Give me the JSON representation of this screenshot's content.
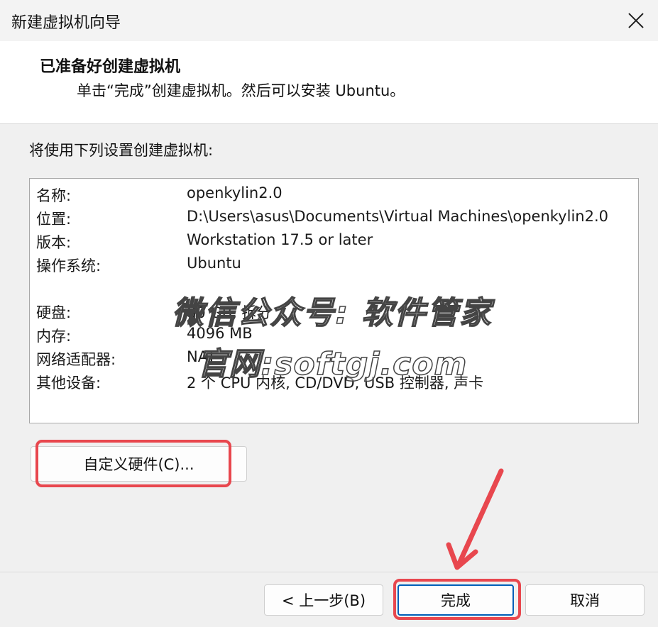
{
  "window": {
    "title": "新建虚拟机向导",
    "close_icon": "close-icon"
  },
  "header": {
    "title": "已准备好创建虚拟机",
    "subtitle": "单击“完成”创建虚拟机。然后可以安装 Ubuntu。"
  },
  "intro": "将使用下列设置创建虚拟机:",
  "settings": [
    {
      "label": "名称:",
      "value": "openkylin2.0"
    },
    {
      "label": "位置:",
      "value": "D:\\Users\\asus\\Documents\\Virtual Machines\\openkylin2.0"
    },
    {
      "label": "版本:",
      "value": "Workstation 17.5 or later"
    },
    {
      "label": "操作系统:",
      "value": "Ubuntu"
    },
    {
      "label": "硬盘:",
      "value": "80 GB, 拆分"
    },
    {
      "label": "内存:",
      "value": "4096 MB"
    },
    {
      "label": "网络适配器:",
      "value": "NAT"
    },
    {
      "label": "其他设备:",
      "value": "2 个 CPU 内核, CD/DVD, USB 控制器, 声卡"
    }
  ],
  "buttons": {
    "customize": "自定义硬件(C)...",
    "back": "< 上一步(B)",
    "finish": "完成",
    "cancel": "取消"
  },
  "watermark": {
    "line1": "微信公众号: 软件管家",
    "line2": "官网:softgj.com"
  },
  "colors": {
    "highlight": "#e8474e"
  }
}
